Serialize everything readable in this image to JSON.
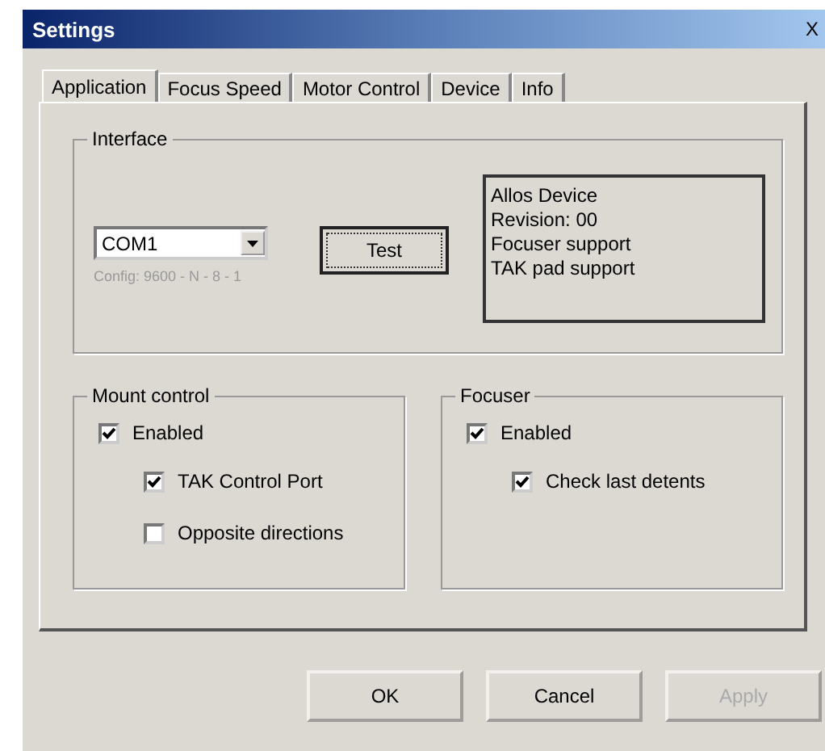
{
  "window": {
    "title": "Settings",
    "close": "X"
  },
  "tabs": [
    {
      "label": "Application",
      "selected": true
    },
    {
      "label": "Focus Speed",
      "selected": false
    },
    {
      "label": "Motor Control",
      "selected": false
    },
    {
      "label": "Device",
      "selected": false
    },
    {
      "label": "Info",
      "selected": false
    }
  ],
  "interface": {
    "title": "Interface",
    "port": "COM1",
    "config": "Config: 9600 - N - 8 - 1",
    "test_button": "Test",
    "info": [
      "Allos Device",
      "Revision: 00",
      "Focuser support",
      "TAK pad support"
    ]
  },
  "groups": [
    {
      "title": "Mount control",
      "options": [
        {
          "label": "Enabled",
          "checked": true,
          "children": [
            {
              "label": "TAK Control Port",
              "checked": true
            },
            {
              "label": "Opposite directions",
              "checked": false
            }
          ]
        }
      ]
    },
    {
      "title": "Focuser",
      "options": [
        {
          "label": "Enabled",
          "checked": true,
          "children": [
            {
              "label": "Check last detents",
              "checked": true
            }
          ]
        }
      ]
    }
  ],
  "buttons": [
    {
      "label": "OK",
      "disabled": false
    },
    {
      "label": "Cancel",
      "disabled": false
    },
    {
      "label": "Apply",
      "disabled": true
    }
  ]
}
